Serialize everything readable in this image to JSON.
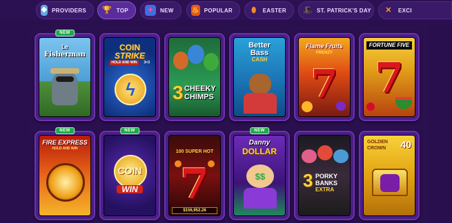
{
  "nav": {
    "items": [
      {
        "label": "PROVIDERS",
        "icon": "providers-icon"
      },
      {
        "label": "TOP",
        "icon": "trophy-icon"
      },
      {
        "label": "NEW",
        "icon": "new-icon"
      },
      {
        "label": "POPULAR",
        "icon": "popular-icon"
      },
      {
        "label": "EASTER",
        "icon": "easter-egg-icon"
      },
      {
        "label": "ST. PATRICK'S DAY",
        "icon": "leprechaun-hat-icon"
      },
      {
        "label": "EXCI",
        "icon": "exclusive-icon"
      }
    ],
    "active": "TOP"
  },
  "badge_label": "NEW",
  "games": {
    "g1": {
      "title_line1": "Le",
      "title_line2": "Fisherman",
      "new": true
    },
    "g2": {
      "title_line1": "COIN",
      "title_line2": "STRIKE",
      "subtitle": "HOLD AND WIN",
      "tag": "3×3",
      "new": false
    },
    "g3": {
      "title_line1": "3",
      "title_line2": "CHEEKY",
      "title_line3": "CHIMPS",
      "new": false
    },
    "g4": {
      "title_line1": "Better",
      "title_line2": "Bass",
      "title_line3": "CASH",
      "new": false
    },
    "g5": {
      "title_line1": "Flame Fruits",
      "title_line2": "FRENZY",
      "symbol": "7",
      "new": false
    },
    "g6": {
      "title_line1": "FORTUNE FIVE",
      "symbol": "7",
      "new": false
    },
    "g7": {
      "title_line1": "FIRE EXPRESS",
      "subtitle": "HOLD AND WIN",
      "new": true
    },
    "g8": {
      "title_line1": "COIN",
      "title_line2": "WIN",
      "new": true
    },
    "g9": {
      "title_line1": "100 SUPER HOT",
      "symbol": "7",
      "jackpot": "$156,952.28",
      "new": false
    },
    "g10": {
      "title_line1": "Danny",
      "title_line2": "DOLLAR",
      "new": true
    },
    "g11": {
      "title_line1": "3",
      "title_line2": "PORKY",
      "title_line3": "BANKS",
      "title_line4": "EXTRA",
      "new": false
    },
    "g12": {
      "title_line1": "GOLDEN",
      "title_line2": "CROWN",
      "tag": "40",
      "new": false
    }
  }
}
